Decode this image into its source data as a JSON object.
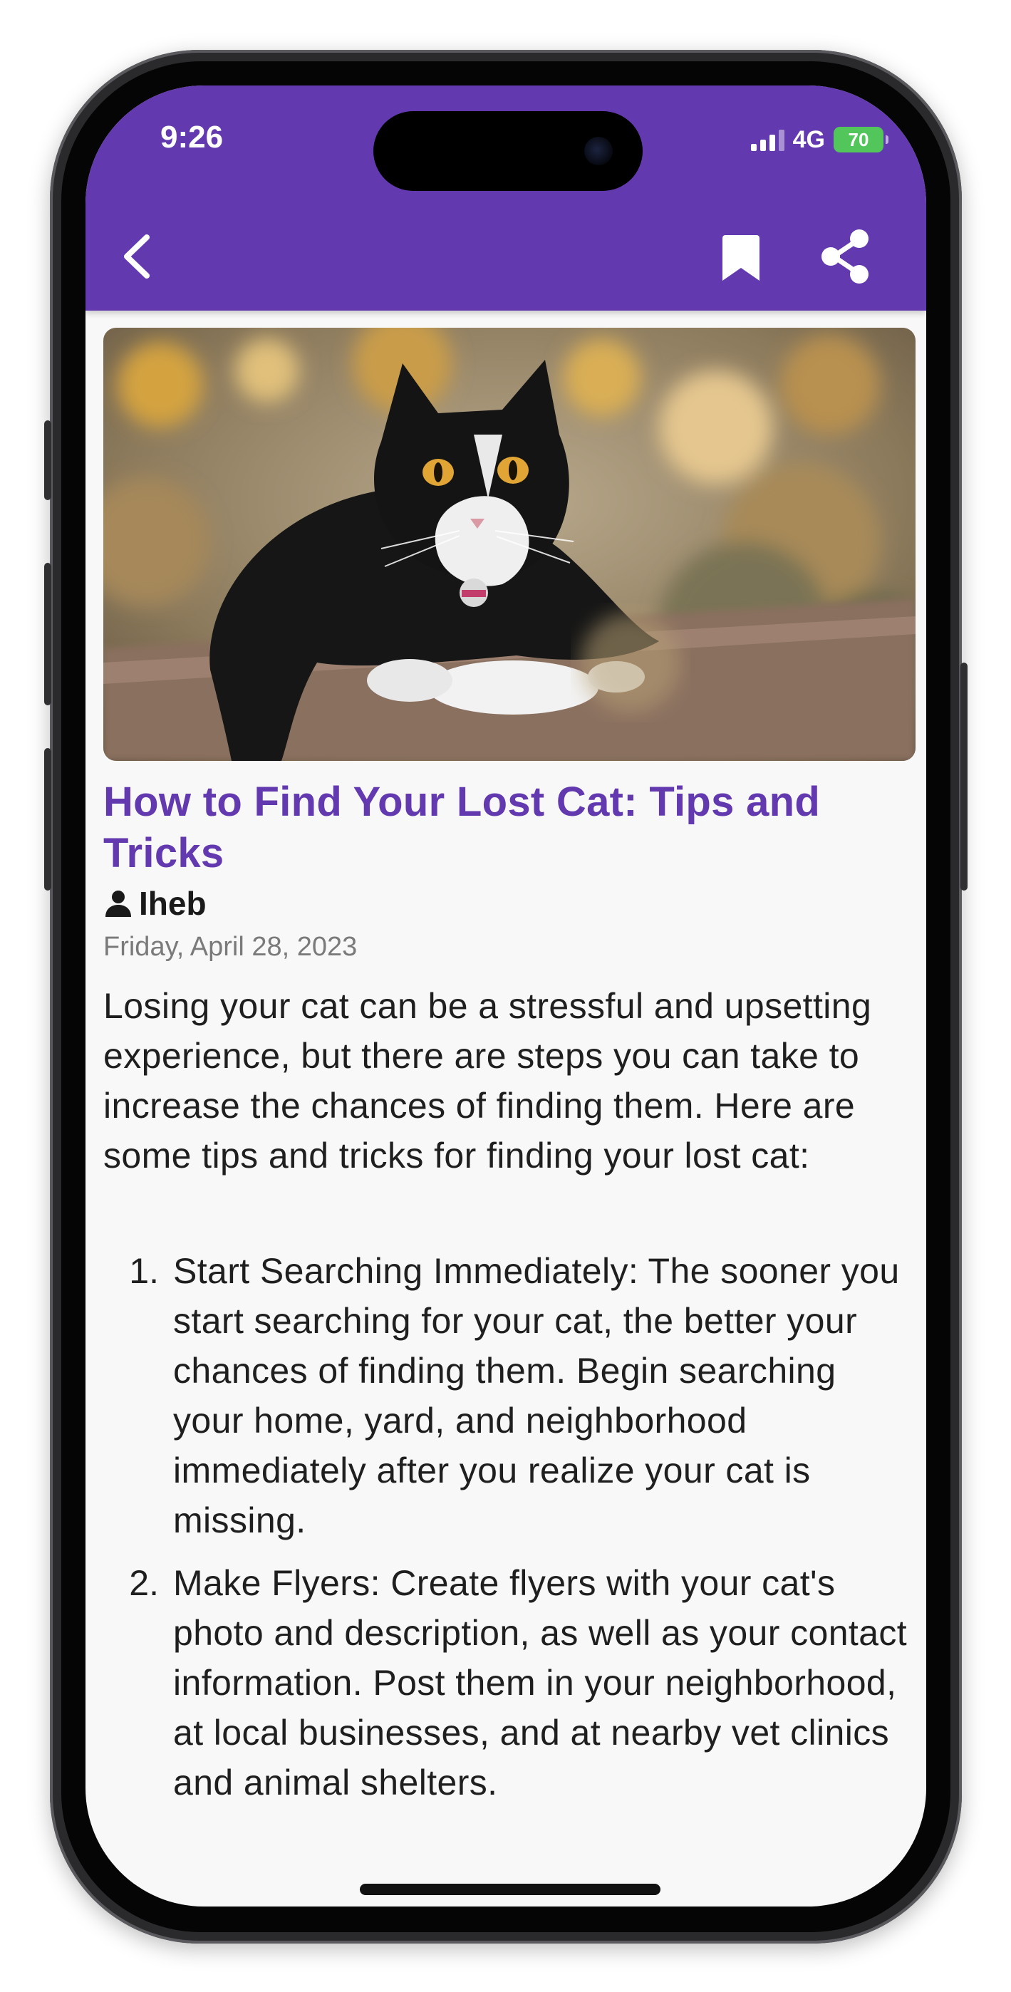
{
  "status_bar": {
    "time": "9:26",
    "network": "4G",
    "battery": "70"
  },
  "header": {
    "background_color": "#6339b0",
    "back_icon": "chevron-left-icon",
    "bookmark_icon": "bookmark-icon",
    "share_icon": "share-icon"
  },
  "article": {
    "image_description_icon": "cat-photo",
    "title": "How to Find Your Lost Cat: Tips and Tricks",
    "author": "Iheb",
    "date": "Friday, April 28, 2023",
    "intro": "Losing your cat can be a stressful and upsetting experience, but there are steps you can take to increase the chances of finding them. Here are some tips and tricks for finding your lost cat:",
    "tips": [
      {
        "number": "1.",
        "text": "Start Searching Immediately: The sooner you start searching for your cat, the better your chances of finding them. Begin searching your home, yard, and neighborhood immediately after you realize your cat is missing."
      },
      {
        "number": "2.",
        "text": "Make Flyers: Create flyers with your cat's photo and description, as well as your contact information. Post them in your neighborhood, at local businesses, and at nearby vet clinics and animal shelters."
      }
    ]
  },
  "colors": {
    "accent": "#6339b0",
    "text": "#1f1f1f",
    "muted": "#7a7a7a"
  }
}
